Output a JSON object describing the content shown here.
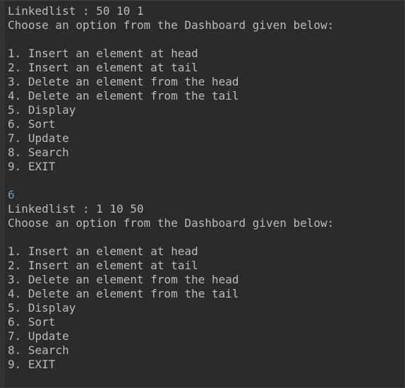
{
  "colors": {
    "background": "#2b2b2b",
    "output_text": "#bbbbbb",
    "user_input": "#6897bb"
  },
  "console": {
    "lines": [
      {
        "text": "Linkedlist : 50 10 1",
        "type": "output"
      },
      {
        "text": "Choose an option from the Dashboard given below:",
        "type": "output"
      },
      {
        "text": "",
        "type": "output"
      },
      {
        "text": "1. Insert an element at head",
        "type": "output"
      },
      {
        "text": "2. Insert an element at tail",
        "type": "output"
      },
      {
        "text": "3. Delete an element from the head",
        "type": "output"
      },
      {
        "text": "4. Delete an element from the tail",
        "type": "output"
      },
      {
        "text": "5. Display",
        "type": "output"
      },
      {
        "text": "6. Sort",
        "type": "output"
      },
      {
        "text": "7. Update",
        "type": "output"
      },
      {
        "text": "8. Search",
        "type": "output"
      },
      {
        "text": "9. EXIT",
        "type": "output"
      },
      {
        "text": "",
        "type": "output"
      },
      {
        "text": "6",
        "type": "input"
      },
      {
        "text": "Linkedlist : 1 10 50",
        "type": "output"
      },
      {
        "text": "Choose an option from the Dashboard given below:",
        "type": "output"
      },
      {
        "text": "",
        "type": "output"
      },
      {
        "text": "1. Insert an element at head",
        "type": "output"
      },
      {
        "text": "2. Insert an element at tail",
        "type": "output"
      },
      {
        "text": "3. Delete an element from the head",
        "type": "output"
      },
      {
        "text": "4. Delete an element from the tail",
        "type": "output"
      },
      {
        "text": "5. Display",
        "type": "output"
      },
      {
        "text": "6. Sort",
        "type": "output"
      },
      {
        "text": "7. Update",
        "type": "output"
      },
      {
        "text": "8. Search",
        "type": "output"
      },
      {
        "text": "9. EXIT",
        "type": "output"
      }
    ]
  }
}
